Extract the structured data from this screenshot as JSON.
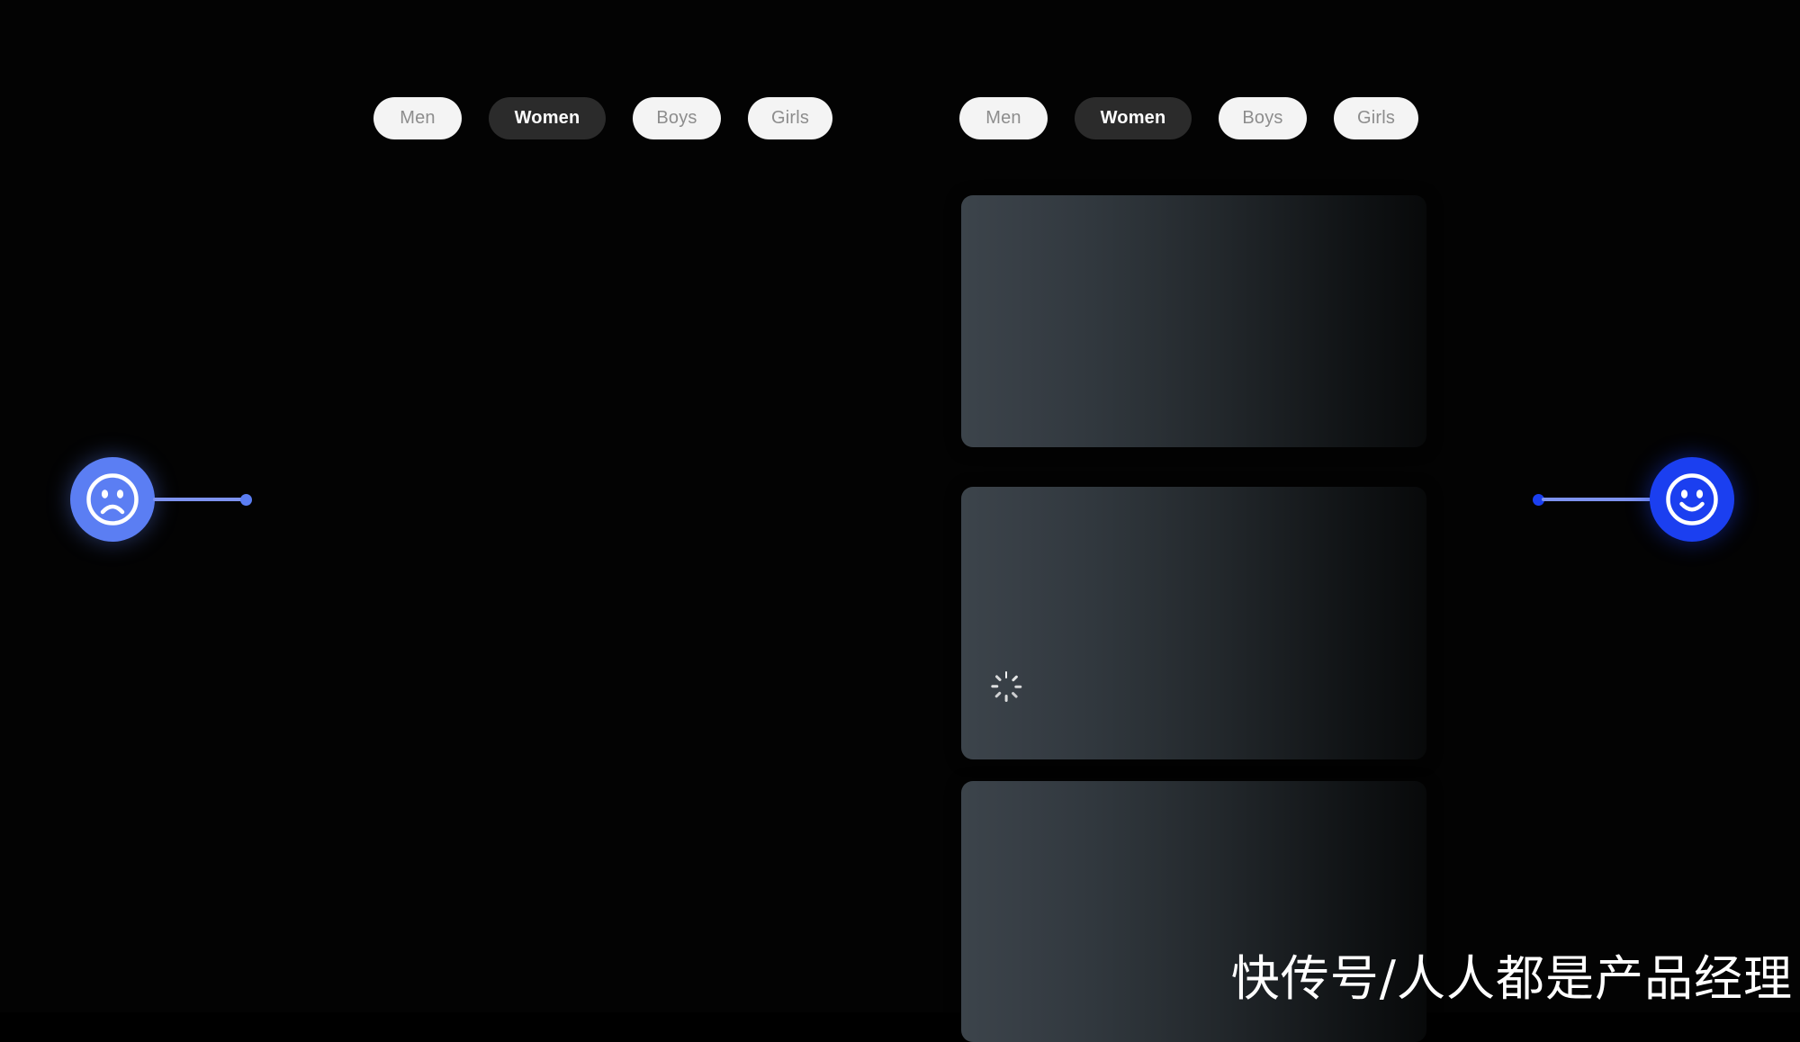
{
  "background_color": "#030303",
  "filters": {
    "left_group": {
      "name": "category-filter-left",
      "options": [
        {
          "label": "Men",
          "state": "inactive"
        },
        {
          "label": "Women",
          "state": "active"
        },
        {
          "label": "Boys",
          "state": "inactive"
        },
        {
          "label": "Girls",
          "state": "inactive"
        }
      ],
      "selected": "Women"
    },
    "right_group": {
      "name": "category-filter-right",
      "options": [
        {
          "label": "Men",
          "state": "inactive"
        },
        {
          "label": "Women",
          "state": "active"
        },
        {
          "label": "Boys",
          "state": "inactive"
        },
        {
          "label": "Girls",
          "state": "inactive"
        }
      ],
      "selected": "Women"
    },
    "colors": {
      "inactive_background": "#f4f4f4",
      "inactive_text": "#8d8d8d",
      "active_background": "#2b2b2b",
      "active_text": "#ffffff"
    }
  },
  "cards": [
    {
      "id": "loading-card-1",
      "state": "loading",
      "icon": "loading-spinner-icon",
      "icon_position": "bottom-left"
    },
    {
      "id": "loading-card-2",
      "state": "loading",
      "icon": "loading-spinner-icon",
      "icon_position": "bottom-left"
    },
    {
      "id": "loading-card-3",
      "state": "loading",
      "icon": null,
      "icon_position": null
    }
  ],
  "card_style": {
    "gradient_from": "#3c444b",
    "gradient_to": "#08090a",
    "corner_radius_px": 13
  },
  "sentiment": {
    "negative": {
      "icon": "sad-face-icon",
      "circle_color": "#5b7ef3",
      "track_color": "#7e93f0",
      "dot_color": "#5b7ef3",
      "side": "left"
    },
    "positive": {
      "icon": "happy-face-icon",
      "circle_color": "#1b3ff0",
      "track_color": "#7e93f0",
      "dot_color": "#1b3ff0",
      "side": "right"
    }
  },
  "watermark": {
    "text": "快传号/人人都是产品经理",
    "color": "#ffffff"
  }
}
